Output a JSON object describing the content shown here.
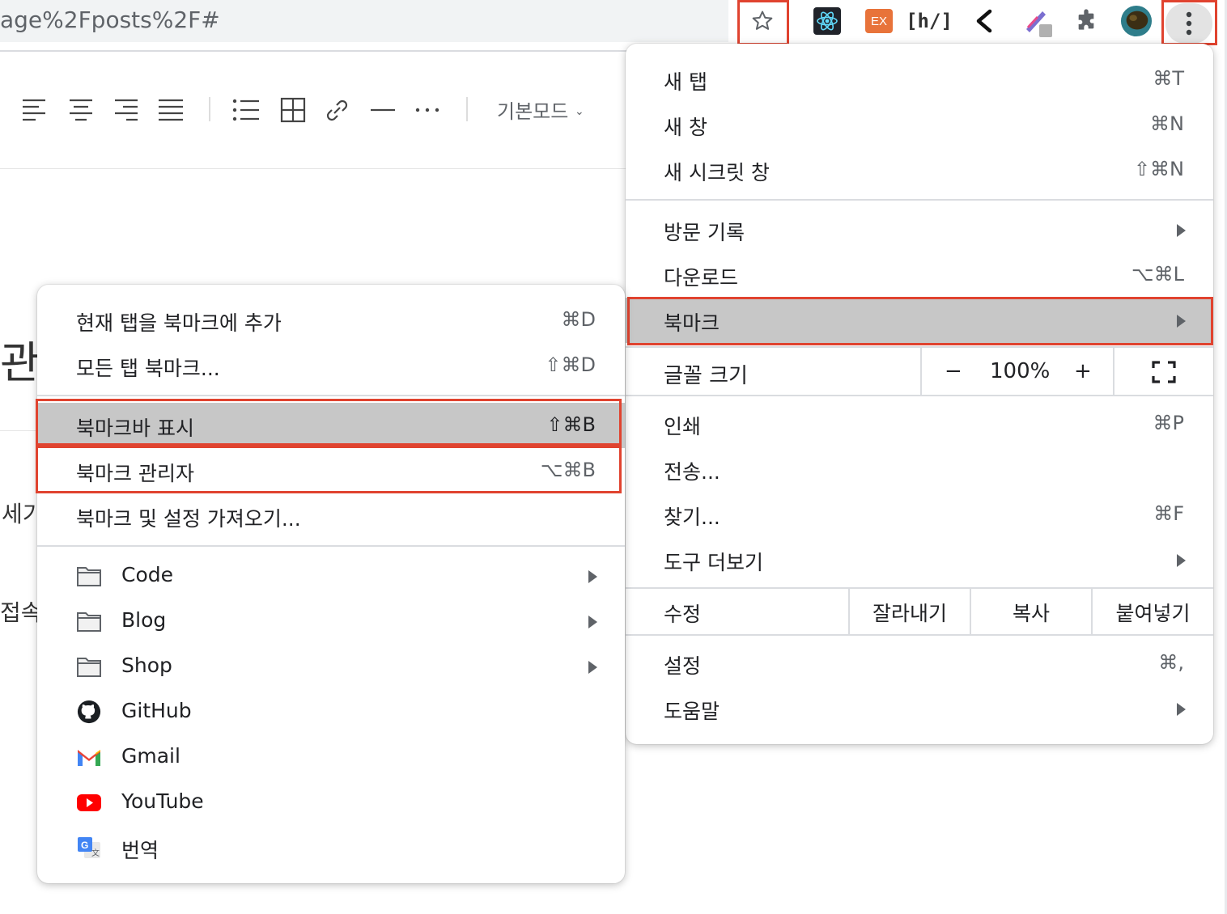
{
  "address_bar": {
    "url_fragment": "age%2Fposts%2F#"
  },
  "extensions": [
    {
      "name": "bookmark-star-icon"
    },
    {
      "name": "react-devtools-icon"
    },
    {
      "name": "ex-extension-icon",
      "text": "EX"
    },
    {
      "name": "hashnode-extension-icon",
      "text": "[h/]"
    },
    {
      "name": "back-arrow-extension-icon"
    },
    {
      "name": "color-picker-extension-icon"
    },
    {
      "name": "extensions-puzzle-icon"
    },
    {
      "name": "profile-avatar"
    },
    {
      "name": "chrome-menu-icon"
    }
  ],
  "editor": {
    "mode_label": "기본모드",
    "fragments": [
      "관",
      "세기",
      "접속"
    ]
  },
  "main_menu": {
    "items": [
      {
        "label": "새 탭",
        "shortcut": "⌘T"
      },
      {
        "label": "새 창",
        "shortcut": "⌘N"
      },
      {
        "label": "새 시크릿 창",
        "shortcut": "⇧⌘N"
      },
      {
        "label": "방문 기록",
        "shortcut": ""
      },
      {
        "label": "다운로드",
        "shortcut": "⌥⌘L"
      },
      {
        "label": "북마크",
        "shortcut": ""
      },
      {
        "label": "인쇄",
        "shortcut": "⌘P"
      },
      {
        "label": "전송...",
        "shortcut": ""
      },
      {
        "label": "찾기...",
        "shortcut": "⌘F"
      },
      {
        "label": "도구 더보기",
        "shortcut": ""
      },
      {
        "label": "설정",
        "shortcut": "⌘,"
      },
      {
        "label": "도움말",
        "shortcut": ""
      }
    ],
    "zoom": {
      "label": "글꼴 크기",
      "minus": "−",
      "value": "100%",
      "plus": "+"
    },
    "edit": {
      "label": "수정",
      "cut": "잘라내기",
      "copy": "복사",
      "paste": "붙여넣기"
    }
  },
  "bookmark_menu": {
    "items": [
      {
        "label": "현재 탭을 북마크에 추가",
        "shortcut": "⌘D"
      },
      {
        "label": "모든 탭 북마크...",
        "shortcut": "⇧⌘D"
      },
      {
        "label": "북마크바 표시",
        "shortcut": "⇧⌘B"
      },
      {
        "label": "북마크 관리자",
        "shortcut": "⌥⌘B"
      },
      {
        "label": "북마크 및 설정 가져오기...",
        "shortcut": ""
      }
    ],
    "bookmarks": [
      {
        "label": "Code",
        "icon": "folder-icon"
      },
      {
        "label": "Blog",
        "icon": "folder-icon"
      },
      {
        "label": "Shop",
        "icon": "folder-icon"
      },
      {
        "label": "GitHub",
        "icon": "github-icon"
      },
      {
        "label": "Gmail",
        "icon": "gmail-icon"
      },
      {
        "label": "YouTube",
        "icon": "youtube-icon"
      },
      {
        "label": "번역",
        "icon": "google-translate-icon"
      }
    ]
  },
  "colors": {
    "highlight": "#c7c7c7",
    "annotation_red": "#e0432f",
    "react_blue": "#61dafb",
    "ex_orange": "#e8733a"
  }
}
